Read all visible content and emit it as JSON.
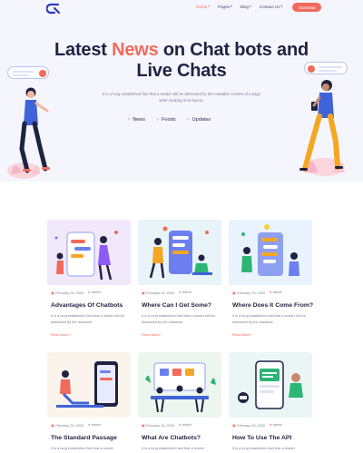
{
  "nav": {
    "items": [
      {
        "label": "Home",
        "active": true
      },
      {
        "label": "Pages",
        "active": false
      },
      {
        "label": "Blog",
        "active": false
      },
      {
        "label": "Contact Us",
        "active": false
      }
    ],
    "download_label": "Download"
  },
  "hero": {
    "title_before": "Latest ",
    "title_highlight": "News",
    "title_after": " on Chat bots and Live Chats",
    "description": "It is a long established fact that a reader will be distracted by the readable content of a page when looking at its layout.",
    "tags": [
      "News",
      "Foods",
      "Updates"
    ]
  },
  "colors": {
    "accent": "#f26a5b",
    "heading": "#1f2240",
    "hero_bg": "#f5f6fd"
  },
  "posts": [
    {
      "date": "February 24, 2020",
      "author": "admin",
      "title": "Advantages Of Chatbots",
      "excerpt": "It is a long established fact that a reader will be distracted by the readable.",
      "link": "Read More"
    },
    {
      "date": "February 24, 2020",
      "author": "admin",
      "title": "Where Can I Get Some?",
      "excerpt": "It is a long established fact that a reader will be distracted by the readable.",
      "link": "Read More"
    },
    {
      "date": "February 24, 2020",
      "author": "admin",
      "title": "Where Does It Come From?",
      "excerpt": "It is a long established fact that a reader will be distracted by the readable.",
      "link": "Read More"
    },
    {
      "date": "February 24, 2020",
      "author": "admin",
      "title": "The Standard Passage",
      "excerpt": "It is a long established fact that a reader",
      "link": ""
    },
    {
      "date": "February 24, 2020",
      "author": "admin",
      "title": "What Are Chatbots?",
      "excerpt": "It is a long established fact that a reader",
      "link": ""
    },
    {
      "date": "February 24, 2020",
      "author": "admin",
      "title": "How To Use The API",
      "excerpt": "It is a long established fact that a reader",
      "link": ""
    }
  ]
}
